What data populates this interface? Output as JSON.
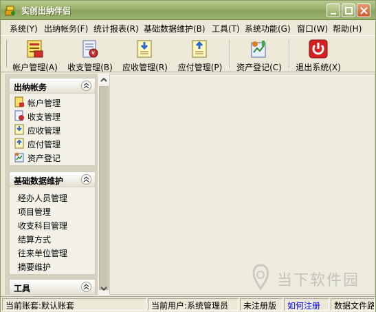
{
  "window": {
    "title": "实创出纳伴侣"
  },
  "menubar": [
    "系统(Y)",
    "出纳帐务(F)",
    "统计报表(R)",
    "基础数据维护(B)",
    "工具(T)",
    "系统功能(G)",
    "窗口(W)",
    "帮助(H)"
  ],
  "toolbar": {
    "buttons": [
      {
        "label": "帐户管理(A)",
        "icon": "account-ledger-icon"
      },
      {
        "label": "收支管理(B)",
        "icon": "income-expense-icon"
      },
      {
        "label": "应收管理(R)",
        "icon": "receivable-icon"
      },
      {
        "label": "应付管理(P)",
        "icon": "payable-icon"
      },
      {
        "label": "资产登记(C)",
        "icon": "asset-register-icon"
      },
      {
        "label": "退出系统(X)",
        "icon": "power-icon"
      }
    ]
  },
  "sidebar": {
    "groups": [
      {
        "title": "出纳帐务",
        "items": [
          "帐户管理",
          "收支管理",
          "应收管理",
          "应付管理",
          "资产登记"
        ]
      },
      {
        "title": "基础数据维护",
        "items": [
          "经办人员管理",
          "项目管理",
          "收支科目管理",
          "结算方式",
          "往来单位管理",
          "摘要维护"
        ]
      },
      {
        "title": "工具",
        "items": []
      }
    ]
  },
  "statusbar": {
    "account": "当前账套:默认账套",
    "user": "当前用户:系统管理员",
    "reg_status": "未注册版",
    "register_link": "如何注册",
    "data_file": "数据文件路"
  },
  "watermark": {
    "text": "当下软件园"
  },
  "colors": {
    "title_bar": "#98b06a",
    "link": "#0000ee",
    "accent_red": "#d42020"
  }
}
